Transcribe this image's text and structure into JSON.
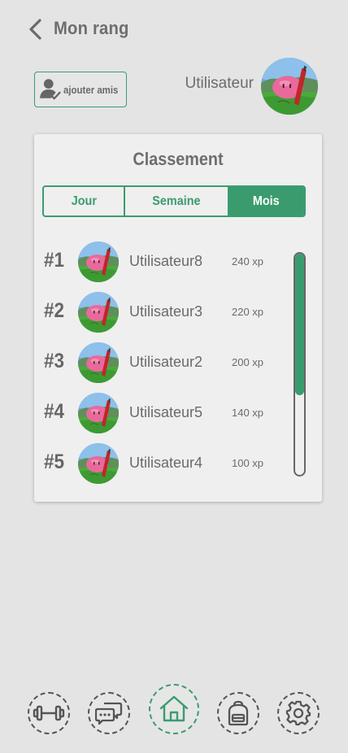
{
  "header": {
    "title": "Mon rang"
  },
  "add_friends": {
    "label": "ajouter amis"
  },
  "current_user": {
    "name": "Utilisateur"
  },
  "leaderboard": {
    "title": "Classement",
    "tabs": [
      {
        "label": "Jour",
        "active": false
      },
      {
        "label": "Semaine",
        "active": false
      },
      {
        "label": "Mois",
        "active": true
      }
    ],
    "rows": [
      {
        "rank": "#1",
        "name": "Utilisateur8",
        "xp": "240 xp"
      },
      {
        "rank": "#2",
        "name": "Utilisateur3",
        "xp": "220 xp"
      },
      {
        "rank": "#3",
        "name": "Utilisateur2",
        "xp": "200 xp"
      },
      {
        "rank": "#4",
        "name": "Utilisateur5",
        "xp": "140 xp"
      },
      {
        "rank": "#5",
        "name": "Utilisateur4",
        "xp": "100 xp"
      }
    ],
    "scroll_position": 0.0,
    "visible_fraction": 0.64
  },
  "bottom_nav": [
    {
      "icon": "dumbbell-icon",
      "active": false
    },
    {
      "icon": "chat-icon",
      "active": false
    },
    {
      "icon": "home-icon",
      "active": true
    },
    {
      "icon": "backpack-icon",
      "active": false
    },
    {
      "icon": "gear-icon",
      "active": false
    }
  ],
  "colors": {
    "accent": "#3a9c6e",
    "background": "#e4e4e4",
    "card": "#efefef",
    "text": "#6b6b6b"
  }
}
